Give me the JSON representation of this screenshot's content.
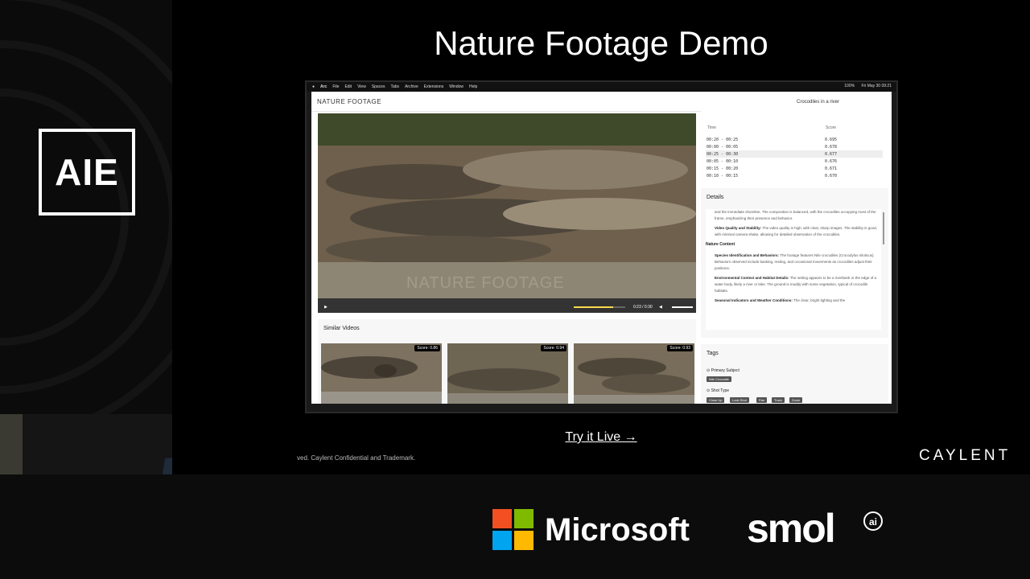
{
  "slide": {
    "title": "Nature Footage Demo",
    "try_live": "Try it Live →",
    "footer_text": "ved. Caylent Confidential and Trademark.",
    "caylent": "CAYLENT",
    "aie": "AIE",
    "sponsors": {
      "microsoft": "Microsoft",
      "smol": "smol",
      "smol_ai": "ai"
    }
  },
  "menubar": {
    "items": [
      "Arc",
      "File",
      "Edit",
      "View",
      "Spaces",
      "Tabs",
      "Archive",
      "Extensions",
      "Window",
      "Help"
    ],
    "battery": "100%",
    "clock": "Fri May 30 09:21"
  },
  "app": {
    "brand": "NATURE FOOTAGE",
    "search_value": "Crocodiles in a river",
    "video": {
      "watermark": "NATURE FOOTAGE",
      "time": "0:23 / 0:30",
      "progress": 0.77
    },
    "similar": {
      "title": "Similar Videos",
      "items": [
        {
          "score": "Score: 0.86"
        },
        {
          "score": "Score: 0.94"
        },
        {
          "score": "Score: 0.93"
        }
      ]
    },
    "segments": {
      "time_header": "Time",
      "score_header": "Score",
      "rows": [
        {
          "time": "00:20 - 00:25",
          "score": "0.695"
        },
        {
          "time": "00:00 - 00:05",
          "score": "0.678"
        },
        {
          "time": "00:25 - 00:30",
          "score": "0.677"
        },
        {
          "time": "00:05 - 00:10",
          "score": "0.676"
        },
        {
          "time": "00:15 - 00:20",
          "score": "0.671"
        },
        {
          "time": "00:10 - 00:15",
          "score": "0.670"
        }
      ]
    },
    "details": {
      "title": "Details",
      "intro": "and the immediate shoreline. The composition is balanced, with the crocodiles occupying most of the frame, emphasizing their presence and behavior.",
      "quality_head": "Video Quality and Stability:",
      "quality_text": "The video quality is high, with clear, sharp images. The stability is good, with minimal camera shake, allowing for detailed observation of the crocodiles.",
      "nature_title": "Nature Content",
      "species_head": "Species Identification and Behaviors:",
      "species_text": "The footage features Nile crocodiles (Crocodylus niloticus). Behaviors observed include basking, resting, and occasional movements as crocodiles adjust their positions.",
      "env_head": "Environmental Context and Habitat Details:",
      "env_text": "The setting appears to be a riverbank or the edge of a water body, likely a river or lake. The ground is muddy with some vegetation, typical of crocodile habitats.",
      "season_head": "Seasonal Indicators and Weather Conditions:",
      "season_text": "The clear, bright lighting and the"
    },
    "tags": {
      "title": "Tags",
      "primary_label": "Primary Subject",
      "primary_chip": "Nile Crocodile",
      "shot_label": "Shot Type",
      "shot_chips": [
        "Close Up",
        "Lock Shot",
        "Pan",
        "Track",
        "Zoom"
      ]
    }
  }
}
